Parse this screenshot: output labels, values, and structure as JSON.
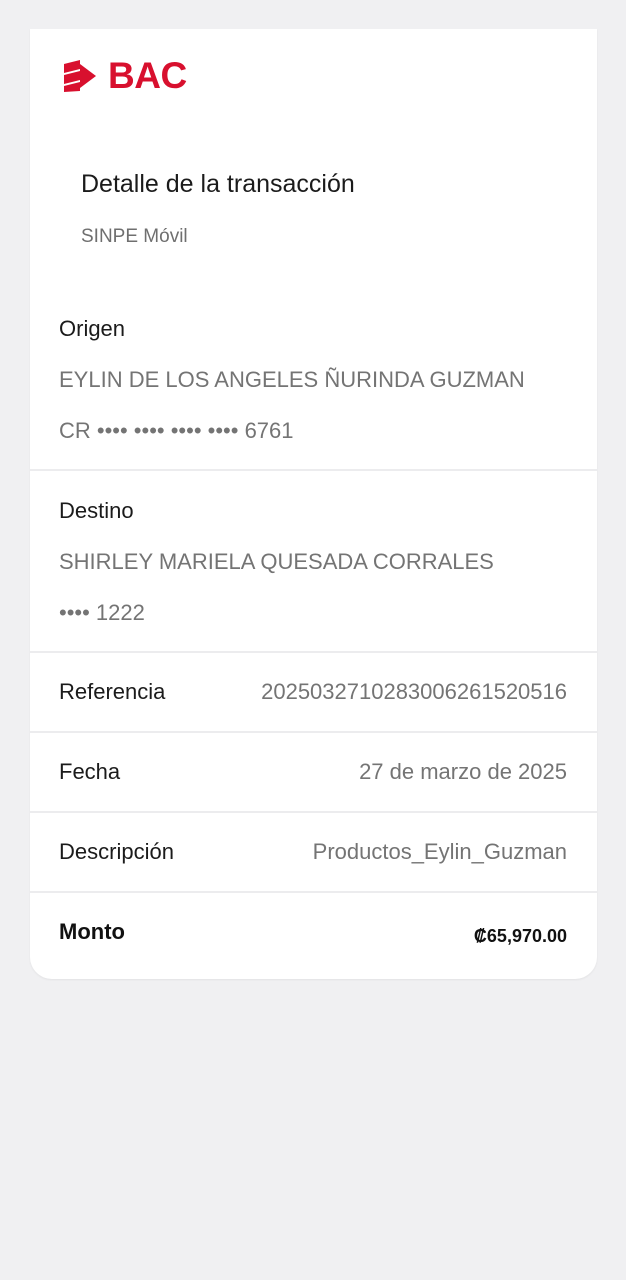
{
  "brand": {
    "name": "BAC",
    "color": "#d8102e",
    "icon": "bac-logo-icon"
  },
  "header": {
    "title": "Detalle de la transacción",
    "subtitle": "SINPE Móvil"
  },
  "origen": {
    "label": "Origen",
    "name": "EYLIN DE LOS ANGELES ÑURINDA GUZMAN",
    "account": "CR •••• •••• •••• •••• 6761"
  },
  "destino": {
    "label": "Destino",
    "name": "SHIRLEY MARIELA QUESADA CORRALES",
    "account": "•••• 1222"
  },
  "details": {
    "referencia": {
      "label": "Referencia",
      "value": "2025032710283006261520516"
    },
    "fecha": {
      "label": "Fecha",
      "value": "27 de marzo de 2025"
    },
    "descripcion": {
      "label": "Descripción",
      "value": "Productos_Eylin_Guzman"
    },
    "monto": {
      "label": "Monto",
      "value": "₡65,970.00"
    }
  }
}
